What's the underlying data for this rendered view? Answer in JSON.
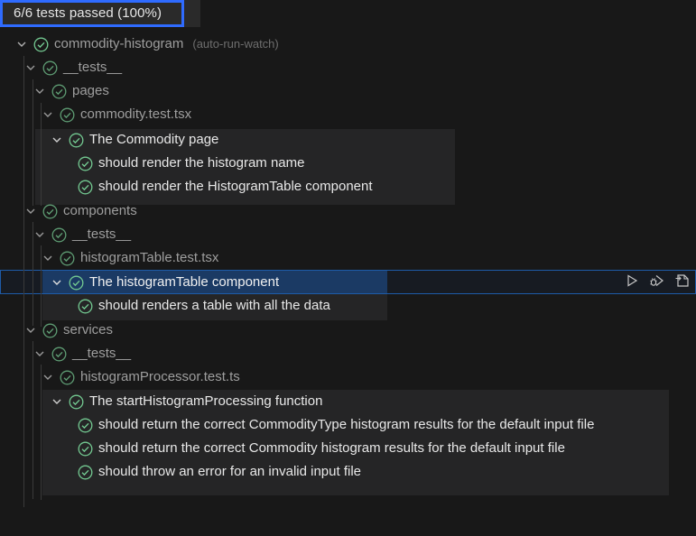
{
  "summary": {
    "text": "6/6 tests passed (100%)"
  },
  "tree": {
    "root": {
      "label": "commodity-histogram",
      "desc": "(auto-run-watch)"
    },
    "tests1": {
      "label": "__tests__"
    },
    "pages": {
      "label": "pages"
    },
    "commodity_file": {
      "label": "commodity.test.tsx"
    },
    "commodity_suite": {
      "label": "The Commodity page"
    },
    "commodity_t1": {
      "label": "should render the histogram name"
    },
    "commodity_t2": {
      "label": "should render the HistogramTable component"
    },
    "components": {
      "label": "components"
    },
    "tests2": {
      "label": "__tests__"
    },
    "histogram_file": {
      "label": "histogramTable.test.tsx"
    },
    "histogram_suite": {
      "label": "The histogramTable component"
    },
    "histogram_t1": {
      "label": "should renders a table with all the data"
    },
    "services": {
      "label": "services"
    },
    "tests3": {
      "label": "__tests__"
    },
    "processor_file": {
      "label": "histogramProcessor.test.ts"
    },
    "processor_suite": {
      "label": "The startHistogramProcessing function"
    },
    "processor_t1": {
      "label": "should return the correct CommodityType histogram results for the default input file"
    },
    "processor_t2": {
      "label": "should return the correct Commodity histogram results for the default input file"
    },
    "processor_t3": {
      "label": "should throw an error for an invalid input file"
    }
  },
  "actions": {
    "run_icon": "run-icon",
    "debug_icon": "debug-icon",
    "goto_icon": "go-to-file-icon"
  },
  "colors": {
    "pass": "#73c991",
    "selection": "#1b3a64",
    "focus_border": "#2f6bff"
  }
}
